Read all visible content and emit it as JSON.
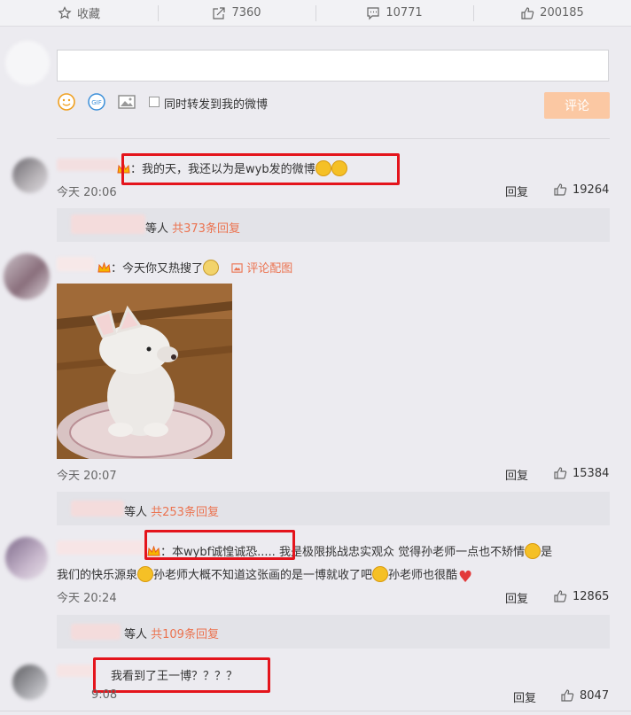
{
  "action_bar": {
    "favorite_label": "收藏",
    "repost_count": "7360",
    "comment_count": "10771",
    "like_count": "200185"
  },
  "composer": {
    "repost_checkbox_label": "同时转发到我的微博",
    "submit_label": "评论"
  },
  "comments": [
    {
      "text": "：我的天，我还以为是wyb发的微博",
      "time": "今天 20:06",
      "reply_label": "回复",
      "likes": "19264",
      "sub_prefix": "等人 ",
      "sub_count": "共373条回复"
    },
    {
      "text": "：今天你又热搜了",
      "image_link": "评论配图",
      "time": "今天 20:07",
      "reply_label": "回复",
      "likes": "15384",
      "sub_prefix": "等人 ",
      "sub_count": "共253条回复"
    },
    {
      "text_part1": "：本wybf诚惶诚恐..... 我是极限挑战忠实观众 觉得孙老师一点也不矫情",
      "text_part2": "是",
      "text_line2a": "我们的快乐源泉",
      "text_line2b": "孙老师大概不知道这张画的是一博就收了吧",
      "text_line2c": "孙老师也很酷",
      "time": "今天 20:24",
      "reply_label": "回复",
      "likes": "12865",
      "sub_prefix": "等人 ",
      "sub_count": "共109条回复"
    },
    {
      "text": "我看到了王一博？？？？",
      "time_partial": "9:08",
      "reply_label": "回复",
      "likes": "8047"
    }
  ],
  "colors": {
    "accent_orange": "#eb7350",
    "highlight_red": "#e4141c",
    "submit_disabled": "#fbc8a3"
  }
}
